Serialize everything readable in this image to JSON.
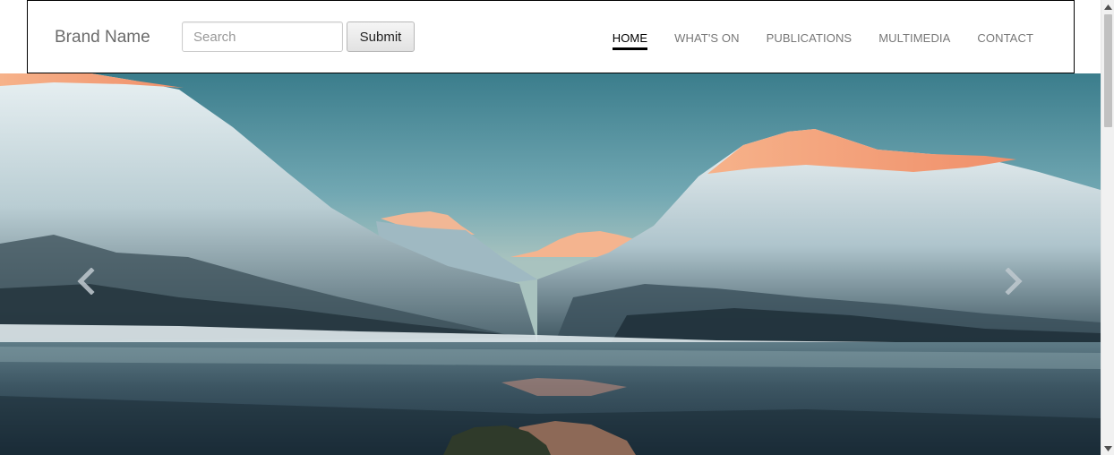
{
  "navbar": {
    "brand": "Brand Name",
    "search": {
      "placeholder": "Search",
      "value": ""
    },
    "submit_label": "Submit",
    "items": [
      {
        "label": "HOME",
        "active": true
      },
      {
        "label": "WHAT'S ON",
        "active": false
      },
      {
        "label": "PUBLICATIONS",
        "active": false
      },
      {
        "label": "MULTIMEDIA",
        "active": false
      },
      {
        "label": "CONTACT",
        "active": false
      }
    ]
  },
  "carousel": {
    "image": "snowy-mountains-fjord-reflection",
    "prev_icon": "chevron-left-icon",
    "next_icon": "chevron-right-icon"
  },
  "colors": {
    "nav_active": "#000000",
    "nav_inactive": "#777777",
    "brand": "#6b6b6b",
    "sky": "#6aa3b1",
    "alpenglow": "#f0a37a"
  }
}
